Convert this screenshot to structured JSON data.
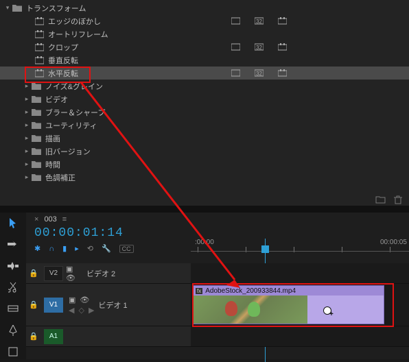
{
  "effects": {
    "transform_group": "トランスフォーム",
    "leaves": [
      {
        "label": "エッジのぼかし",
        "badges": true
      },
      {
        "label": "オートリフレーム",
        "badges": false
      },
      {
        "label": "クロップ",
        "badges": true
      },
      {
        "label": "垂直反転",
        "badges": false
      },
      {
        "label": "水平反転",
        "badges": true
      }
    ],
    "siblings": [
      "ノイズ&グレイン",
      "ビデオ",
      "ブラー＆シャープ",
      "ユーティリティ",
      "描画",
      "旧バージョン",
      "時間",
      "色調補正"
    ]
  },
  "timeline": {
    "sequence_name": "003",
    "timecode": "00:00:01:14",
    "ruler": {
      "t0": ":00:00",
      "t1": "00:00:05"
    },
    "tracks": {
      "v2": {
        "tag": "V2",
        "name": "ビデオ 2"
      },
      "v1": {
        "tag": "V1",
        "name": "ビデオ 1"
      },
      "a1": {
        "tag": "A1"
      }
    },
    "clip": {
      "filename": "AdobeStock_200933844.mp4"
    }
  },
  "annot": {
    "highlight_index": 4
  }
}
